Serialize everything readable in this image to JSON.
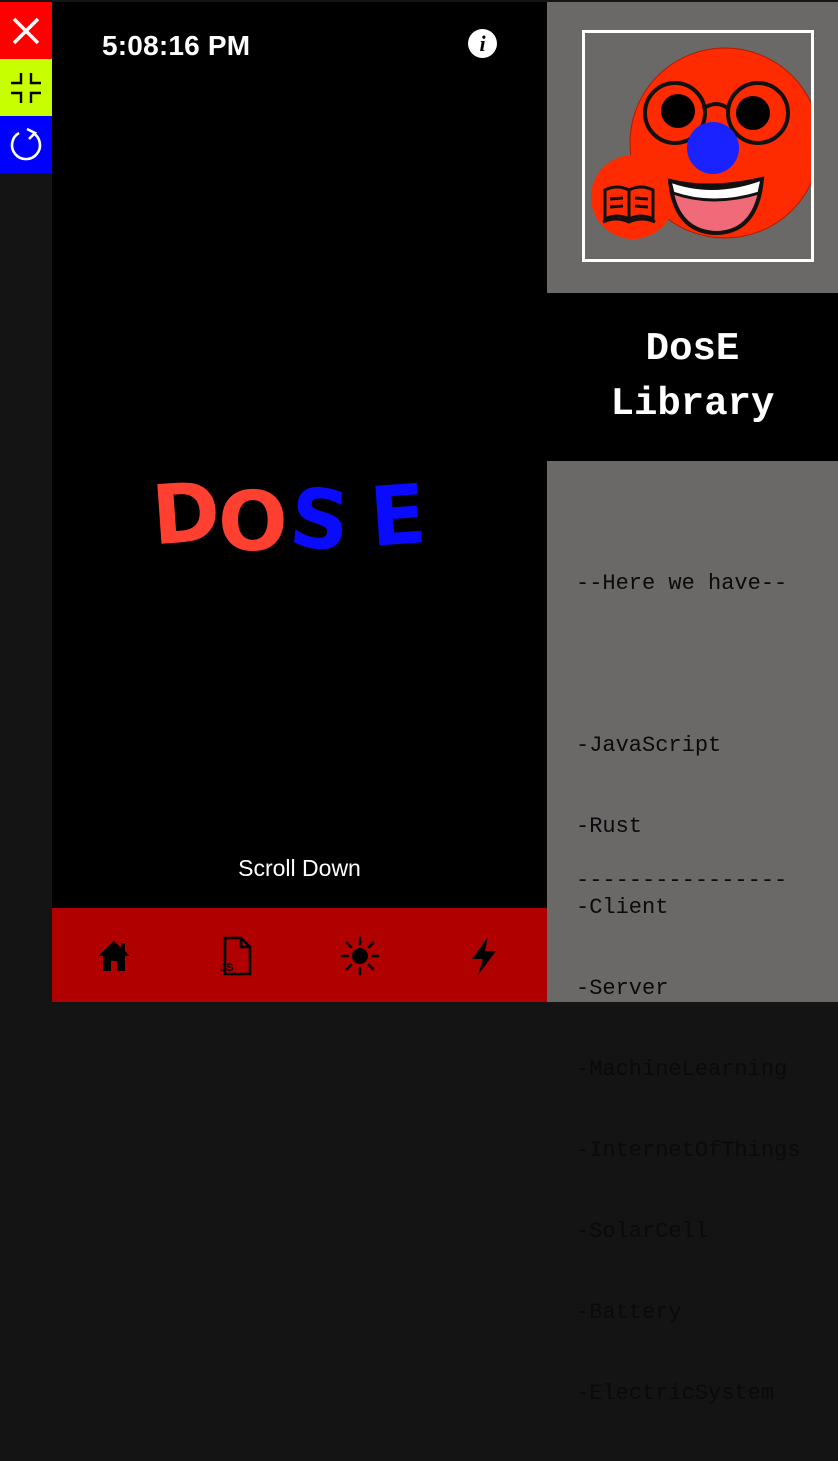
{
  "window_controls": {
    "close_icon": "close-icon",
    "minimize_icon": "shrink-icon",
    "reload_icon": "refresh-icon",
    "colors": {
      "close": "#ff0000",
      "minimize": "#c8ff00",
      "reload": "#0000ff"
    }
  },
  "header": {
    "clock": "5:08:16 PM",
    "info_label": "i"
  },
  "hero": {
    "letters": [
      "D",
      "O",
      "S",
      "E"
    ],
    "letter_colors": [
      "#ff4030",
      "#ff4030",
      "#0a0aff",
      "#0a0aff"
    ],
    "scroll_hint": "Scroll Down"
  },
  "bottom_nav": {
    "background": "#b00000",
    "items": [
      {
        "icon": "home-icon"
      },
      {
        "icon": "js-file-icon",
        "label": "JS"
      },
      {
        "icon": "sun-icon"
      },
      {
        "icon": "lightning-icon"
      }
    ]
  },
  "sidebar": {
    "logo_icon": "mascot-logo-icon",
    "title_line1": "DosE",
    "title_line2": "Library",
    "intro": "--Here we have--",
    "topics": [
      "-JavaScript",
      "-Rust",
      "-Client",
      "-Server",
      "-MachineLearning",
      "-InternetOfThings",
      "-SolarCell",
      "-Battery",
      "-ElectricSystem"
    ],
    "divider": "----------------"
  }
}
